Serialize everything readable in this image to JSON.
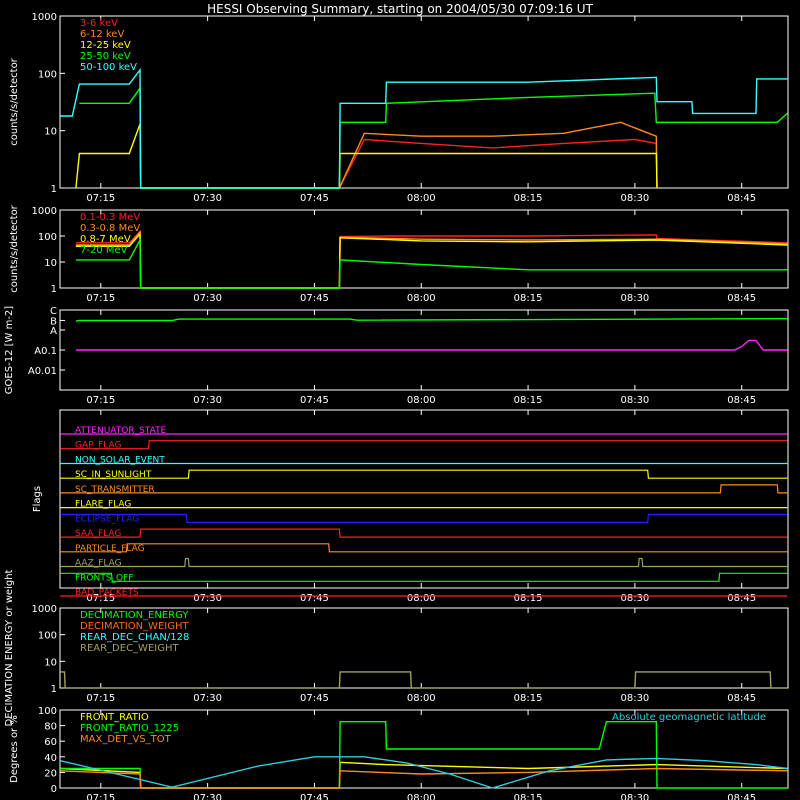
{
  "title": "HESSI Observing Summary, starting on 2004/05/30 07:09:16 UT",
  "x_ticks": [
    "07:15",
    "07:30",
    "07:45",
    "08:00",
    "08:15",
    "08:30",
    "08:45"
  ],
  "x_tick_minutes": [
    15,
    30,
    45,
    60,
    75,
    90,
    105
  ],
  "x_range_minutes": [
    9.27,
    111.5
  ],
  "chart_data": [
    {
      "type": "line",
      "name": "countrate-low",
      "ylabel": "counts/s/detector",
      "yscale": "log",
      "ylim": [
        1,
        1000
      ],
      "yticks": [
        "1",
        "10",
        "100",
        "1000"
      ],
      "x_units": "minutes after 06:00 UT",
      "series": [
        {
          "name": "3-6 keV",
          "color": "#ff2020",
          "x": [
            9.5,
            20.5,
            48.5,
            52,
            60,
            70,
            80,
            90,
            93,
            93.1
          ],
          "y": [
            null,
            null,
            1,
            7,
            6,
            5,
            6,
            7,
            6,
            1
          ]
        },
        {
          "name": "6-12 keV",
          "color": "#ff8c1a",
          "x": [
            9.5,
            20.5,
            48.5,
            52,
            60,
            70,
            80,
            88,
            91,
            93,
            93.1
          ],
          "y": [
            null,
            null,
            1,
            9,
            8,
            8,
            9,
            14,
            10,
            8,
            1
          ]
        },
        {
          "name": "12-25 keV",
          "color": "#ffff00",
          "x": [
            11.5,
            12,
            19,
            20.5,
            20.6,
            48.5,
            48.6,
            60,
            70,
            80,
            90,
            93,
            93.1
          ],
          "y": [
            1,
            4,
            4,
            13,
            1,
            1,
            4,
            4,
            4,
            4,
            4,
            4,
            1
          ]
        },
        {
          "name": "25-50 keV",
          "color": "#00ff00",
          "x": [
            9.3,
            11,
            12,
            19,
            20.5,
            20.6,
            48.5,
            48.6,
            55,
            55.1,
            75,
            92.8,
            93,
            107,
            110,
            111.4
          ],
          "y": [
            null,
            null,
            30,
            30,
            55,
            1,
            1,
            14,
            14,
            30,
            38,
            45,
            14,
            14,
            14,
            20
          ]
        },
        {
          "name": "50-100 keV",
          "color": "#33ffff",
          "x": [
            9.3,
            11,
            12,
            19,
            20.5,
            20.6,
            48.5,
            48.6,
            55,
            55.1,
            75,
            92.8,
            93,
            93.1,
            98,
            98.1,
            107,
            107.1,
            111.4
          ],
          "y": [
            18,
            18,
            65,
            65,
            115,
            1,
            1,
            30,
            30,
            70,
            70,
            85,
            85,
            32,
            32,
            20,
            20,
            80,
            80
          ]
        }
      ]
    },
    {
      "type": "line",
      "name": "countrate-high",
      "ylabel": "counts/s/detector",
      "yscale": "log",
      "ylim": [
        1,
        1000
      ],
      "yticks": [
        "1",
        "10",
        "100",
        "1000"
      ],
      "x_units": "minutes after 06:00 UT",
      "series": [
        {
          "name": "0.1-0.3 MeV",
          "color": "#ff2020",
          "x": [
            11.5,
            19,
            20.5,
            20.6,
            48.5,
            48.6,
            55,
            75,
            93,
            93.1,
            111.4
          ],
          "y": [
            55,
            55,
            150,
            1,
            1,
            95,
            100,
            100,
            110,
            80,
            55
          ]
        },
        {
          "name": "0.3-0.8 MeV",
          "color": "#ff8c1a",
          "x": [
            11.5,
            19,
            20.5,
            20.6,
            48.5,
            48.6,
            60,
            75,
            93,
            111.4
          ],
          "y": [
            45,
            45,
            140,
            1,
            1,
            90,
            75,
            70,
            75,
            50
          ]
        },
        {
          "name": "0.8-7 MeV",
          "color": "#ffff00",
          "x": [
            11.5,
            19,
            20.5,
            20.6,
            48.5,
            48.6,
            60,
            75,
            93,
            111.4
          ],
          "y": [
            40,
            40,
            120,
            1,
            1,
            85,
            65,
            60,
            70,
            45
          ]
        },
        {
          "name": "7-20 MeV",
          "color": "#00ff00",
          "x": [
            11.5,
            19,
            20.5,
            20.6,
            48.5,
            48.6,
            60,
            75,
            93,
            111.4
          ],
          "y": [
            12,
            12,
            70,
            1,
            1,
            12,
            8,
            5,
            5,
            5
          ]
        }
      ]
    },
    {
      "type": "line",
      "name": "goes",
      "ylabel": "GOES-12 [W m-2]",
      "yscale": "log",
      "ylim": [
        0.001,
        10
      ],
      "yticks": [
        "A0.01",
        "A0.1",
        "A",
        "B",
        "C"
      ],
      "x_units": "minutes after 06:00 UT",
      "series": [
        {
          "color": "#00ff00",
          "x": [
            11.5,
            12,
            25,
            26,
            50,
            51,
            111.4
          ],
          "y": [
            2.8,
            3.0,
            3.0,
            3.5,
            3.5,
            3.1,
            3.7
          ]
        },
        {
          "color": "#ff22ff",
          "x": [
            11.5,
            15,
            20,
            104,
            105,
            106,
            107,
            108,
            111.4
          ],
          "y": [
            0.1,
            0.1,
            0.1,
            0.1,
            0.15,
            0.3,
            0.3,
            0.1,
            0.1
          ]
        }
      ]
    },
    {
      "type": "line",
      "name": "decimation",
      "ylabel": "DECIMATION ENERGY or weight",
      "yscale": "log",
      "ylim": [
        1,
        1000
      ],
      "yticks": [
        "1",
        "10",
        "100",
        "1000"
      ],
      "x_units": "minutes after 06:00 UT",
      "series": [
        {
          "name": "DECIMATION_ENERGY",
          "color": "#00ff00",
          "x": [],
          "y": []
        },
        {
          "name": "DECIMATION_WEIGHT",
          "color": "#ff6a1a",
          "x": [],
          "y": []
        },
        {
          "name": "REAR_DEC_CHAN/128",
          "color": "#33ffff",
          "x": [],
          "y": []
        },
        {
          "name": "REAR_DEC_WEIGHT",
          "color": "#a0a060",
          "x": [
            9.3,
            9.9,
            10,
            48.5,
            48.6,
            58.5,
            58.6,
            90,
            90.1,
            109,
            109.1,
            111.4
          ],
          "y": [
            4,
            4,
            1,
            1,
            4,
            4,
            1,
            1,
            4,
            4,
            1,
            1
          ]
        }
      ]
    },
    {
      "type": "line",
      "name": "ratios",
      "ylabel": "Degrees or %",
      "ylim": [
        0,
        100
      ],
      "yticks": [
        "0",
        "20",
        "40",
        "60",
        "80",
        "100"
      ],
      "x_units": "minutes after 06:00 UT",
      "annotation": "Absolute geomagnetic latitude",
      "series": [
        {
          "name": "FRONT_RATIO",
          "color": "#ffff00",
          "x": [
            9.3,
            20.5,
            20.6,
            48.5,
            48.6,
            55,
            75,
            93,
            111.4
          ],
          "y": [
            25,
            20,
            0,
            0,
            33,
            30,
            25,
            30,
            25
          ]
        },
        {
          "name": "FRONT_RATIO_1225",
          "color": "#00ff00",
          "x": [
            9.3,
            20.5,
            20.6,
            48.5,
            48.6,
            55,
            55.1,
            85,
            86,
            93,
            93.1,
            111.4
          ],
          "y": [
            25,
            25,
            0,
            0,
            85,
            85,
            50,
            50,
            85,
            85,
            0,
            0
          ]
        },
        {
          "name": "MAX_DET_VS_TOT",
          "color": "#ff8c1a",
          "x": [
            9.3,
            20.5,
            20.6,
            48.5,
            48.6,
            60,
            75,
            93,
            111.4
          ],
          "y": [
            22,
            18,
            0,
            0,
            22,
            18,
            20,
            25,
            22
          ]
        },
        {
          "name": "Absolute geomagnetic latitude",
          "color": "#33ccdd",
          "x": [
            9.3,
            14,
            25,
            37,
            45,
            52,
            58,
            64,
            70,
            78,
            86,
            93,
            100,
            107,
            111.4
          ],
          "y": [
            35,
            25,
            1,
            28,
            40,
            40,
            32,
            18,
            0,
            22,
            36,
            38,
            35,
            30,
            25
          ]
        }
      ]
    },
    {
      "type": "table",
      "name": "flags",
      "ylabel": "Flags",
      "x_units": "minutes after 06:00 UT",
      "rows": [
        {
          "name": "ATTENUATOR_STATE",
          "color": "#ff22ff",
          "x": [
            9.3,
            111.4
          ],
          "level": [
            0,
            0
          ]
        },
        {
          "name": "GAP_FLAG",
          "color": "#ff2020",
          "x": [
            9.3,
            21.7,
            21.8,
            111.4
          ],
          "level": [
            0,
            0,
            1,
            1
          ]
        },
        {
          "name": "NON_SOLAR_EVENT",
          "color": "#33ffff",
          "x": [
            9.3,
            111.4
          ],
          "level": [
            0,
            0
          ]
        },
        {
          "name": "SC_IN_SUNLIGHT",
          "color": "#ffff00",
          "x": [
            9.3,
            27.3,
            27.4,
            91.8,
            91.9,
            111.4
          ],
          "level": [
            0,
            0,
            1,
            1,
            0,
            0
          ]
        },
        {
          "name": "SC_TRANSMITTER",
          "color": "#ff8c1a",
          "x": [
            9.3,
            102,
            102.1,
            110,
            110.1,
            111.4
          ],
          "level": [
            0,
            0,
            1,
            1,
            0,
            0
          ]
        },
        {
          "name": "FLARE_FLAG",
          "color": "#ffff00",
          "x": [
            9.3,
            111.4
          ],
          "level": [
            0,
            0
          ]
        },
        {
          "name": "ECLIPSE_FLAG",
          "color": "#2020ff",
          "x": [
            9.3,
            27,
            27.1,
            91.8,
            91.9,
            111.4
          ],
          "level": [
            1,
            1,
            0,
            0,
            1,
            1
          ]
        },
        {
          "name": "SAA_FLAG",
          "color": "#ff2020",
          "x": [
            9.3,
            20.5,
            20.6,
            48.5,
            48.6,
            111.4
          ],
          "level": [
            0,
            0,
            1,
            1,
            0,
            0
          ]
        },
        {
          "name": "PARTICLE_FLAG",
          "color": "#ff8c1a",
          "x": [
            9.3,
            18.6,
            18.7,
            47,
            47.1,
            111.4
          ],
          "level": [
            0,
            0,
            1,
            1,
            0,
            0
          ]
        },
        {
          "name": "AAZ_FLAG",
          "color": "#a0a060",
          "x": [
            9.3,
            26.8,
            26.9,
            27.3,
            27.4,
            90.5,
            90.6,
            91,
            91.1,
            111.4
          ],
          "level": [
            0,
            0,
            1,
            1,
            0,
            0,
            1,
            1,
            0,
            0
          ]
        },
        {
          "name": "FRONTS_OFF",
          "color": "#00ff00",
          "x": [
            9.3,
            16.5,
            16.6,
            101.8,
            101.9,
            111.4
          ],
          "level": [
            1,
            1,
            0,
            0,
            1,
            1
          ]
        },
        {
          "name": "BAD_PACKETS",
          "color": "#ff2020",
          "x": [
            9.3,
            111.4
          ],
          "level": [
            0,
            0
          ]
        }
      ]
    }
  ]
}
